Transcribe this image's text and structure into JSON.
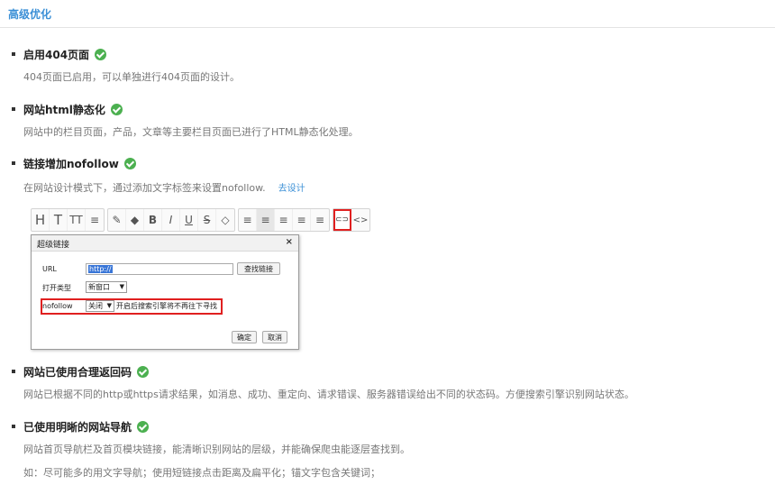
{
  "header": {
    "title": "高级优化"
  },
  "sections": [
    {
      "title": "启用404页面",
      "desc": "404页面已启用，可以单独进行404页面的设计。"
    },
    {
      "title": "网站html静态化",
      "desc": "网站中的栏目页面，产品，文章等主要栏目页面已进行了HTML静态化处理。"
    },
    {
      "title": "链接增加nofollow",
      "desc": "在网站设计模式下，通过添加文字标签来设置nofollow.",
      "link": "去设计"
    },
    {
      "title": "网站已使用合理返回码",
      "desc": "网站已根据不同的http或https请求结果，如消息、成功、重定向、请求错误、服务器错误给出不同的状态码。方便搜索引擎识别网站状态。"
    },
    {
      "title": "已使用明晰的网站导航",
      "desc": "网站首页导航栏及首页模块链接，能清晰识别网站的层级，并能确保爬虫能逐层查找到。",
      "desc2": "如：尽可能多的用文字导航；使用短链接点击距离及扁平化；锚文字包含关键词；"
    }
  ],
  "toolbar": {
    "groups": [
      [
        "H",
        "T",
        "TT",
        "≡"
      ],
      [
        "✎",
        "◆",
        "B",
        "I",
        "U",
        "S",
        "◇"
      ],
      [
        "≡",
        "≡",
        "≡",
        "≡",
        "≡"
      ],
      [
        "⊂⊃",
        "<>"
      ]
    ]
  },
  "dialog": {
    "title": "超级链接",
    "close": "×",
    "url_label": "URL",
    "url_value": "http://",
    "find_link": "查找链接",
    "open_type_label": "打开类型",
    "open_type_value": "新窗口",
    "nofollow_label": "nofollow",
    "nofollow_value": "关闭",
    "nofollow_hint": "开启后搜索引擎将不再往下寻找",
    "ok": "确定",
    "cancel": "取消"
  },
  "colors": {
    "accent": "#3a8fd6",
    "check": "#4cb050",
    "highlight": "#e02020"
  }
}
